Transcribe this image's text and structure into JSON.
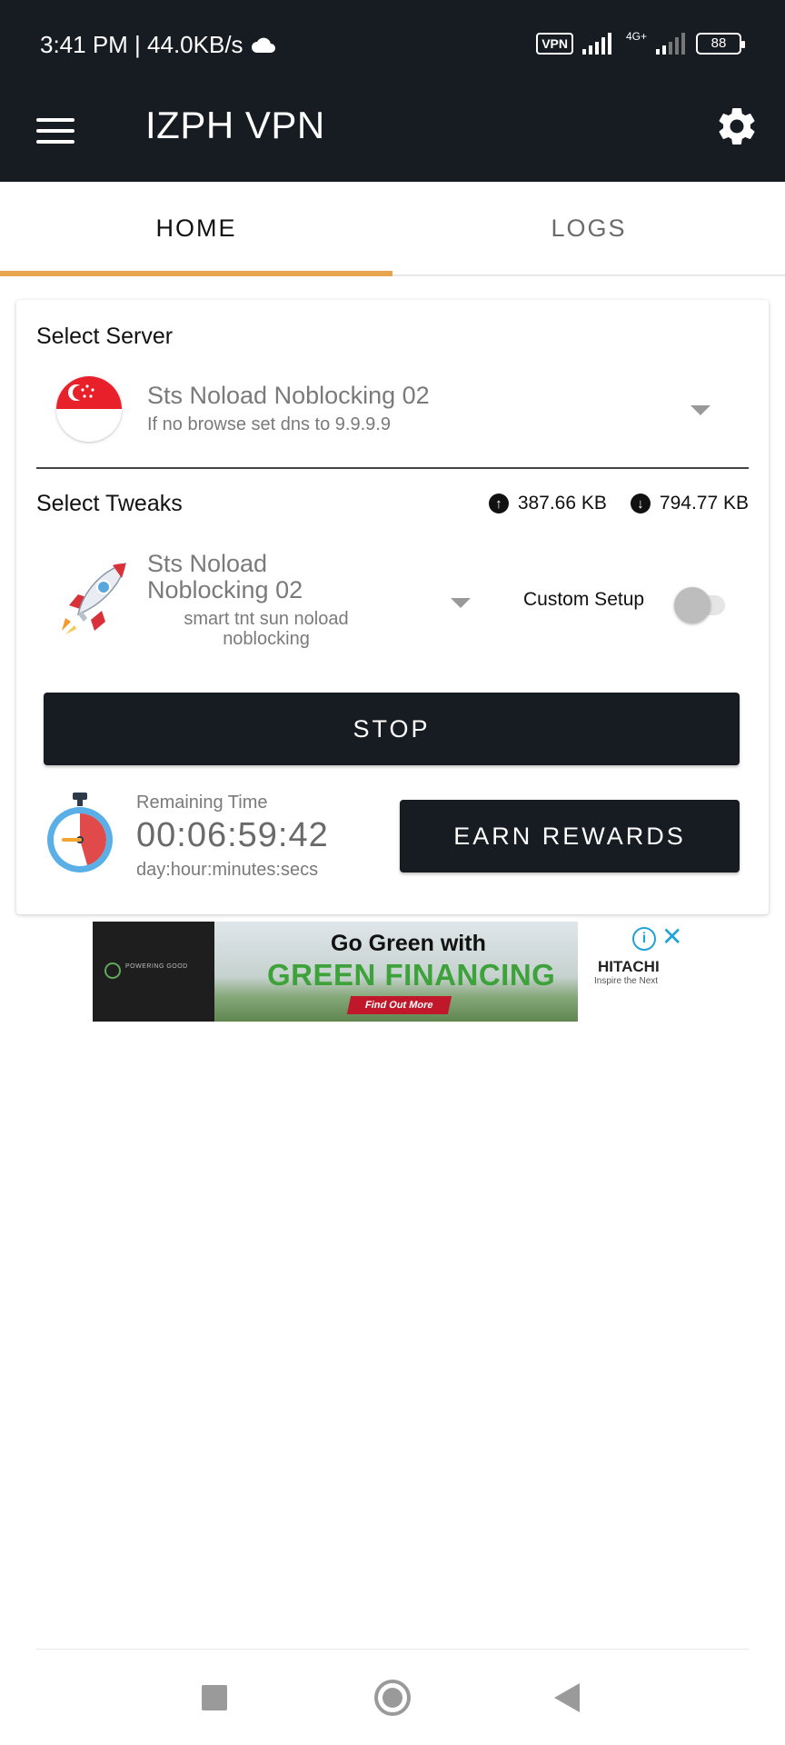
{
  "status_bar": {
    "time_speed": "3:41 PM | 44.0KB/s",
    "weather_icon": "cloud-icon",
    "vpn_badge": "VPN",
    "network_label": "4G+",
    "battery": "88"
  },
  "app_bar": {
    "title": "IZPH VPN",
    "menu_icon": "hamburger-menu-icon",
    "settings_icon": "gear-icon"
  },
  "tabs": [
    {
      "label": "HOME",
      "active": true
    },
    {
      "label": "LOGS",
      "active": false
    }
  ],
  "server": {
    "section_label": "Select Server",
    "name": "Sts Noload Noblocking 02",
    "description": "If no browse set dns to 9.9.9.9",
    "flag_icon": "singapore-flag-icon"
  },
  "tweaks": {
    "section_label": "Select Tweaks",
    "upload": "387.66 KB",
    "download": "794.77 KB",
    "name": "Sts Noload Noblocking 02",
    "description": "smart tnt sun noload noblocking",
    "custom_setup_label": "Custom Setup",
    "custom_setup_enabled": false
  },
  "actions": {
    "stop_label": "STOP",
    "earn_rewards_label": "EARN REWARDS"
  },
  "timer": {
    "label": "Remaining Time",
    "value": "00:06:59:42",
    "format": "day:hour:minutes:secs"
  },
  "ad": {
    "heading": "Go Green with",
    "subheading": "GREEN FINANCING",
    "cta": "Find Out More",
    "brand": "HITACHI",
    "tagline": "Inspire the Next",
    "left_logo_text": "POWERING GOOD"
  },
  "colors": {
    "header_bg": "#171b22",
    "tab_indicator": "#e8a54f",
    "button_bg": "#171b22",
    "ad_green": "#3da23a"
  }
}
